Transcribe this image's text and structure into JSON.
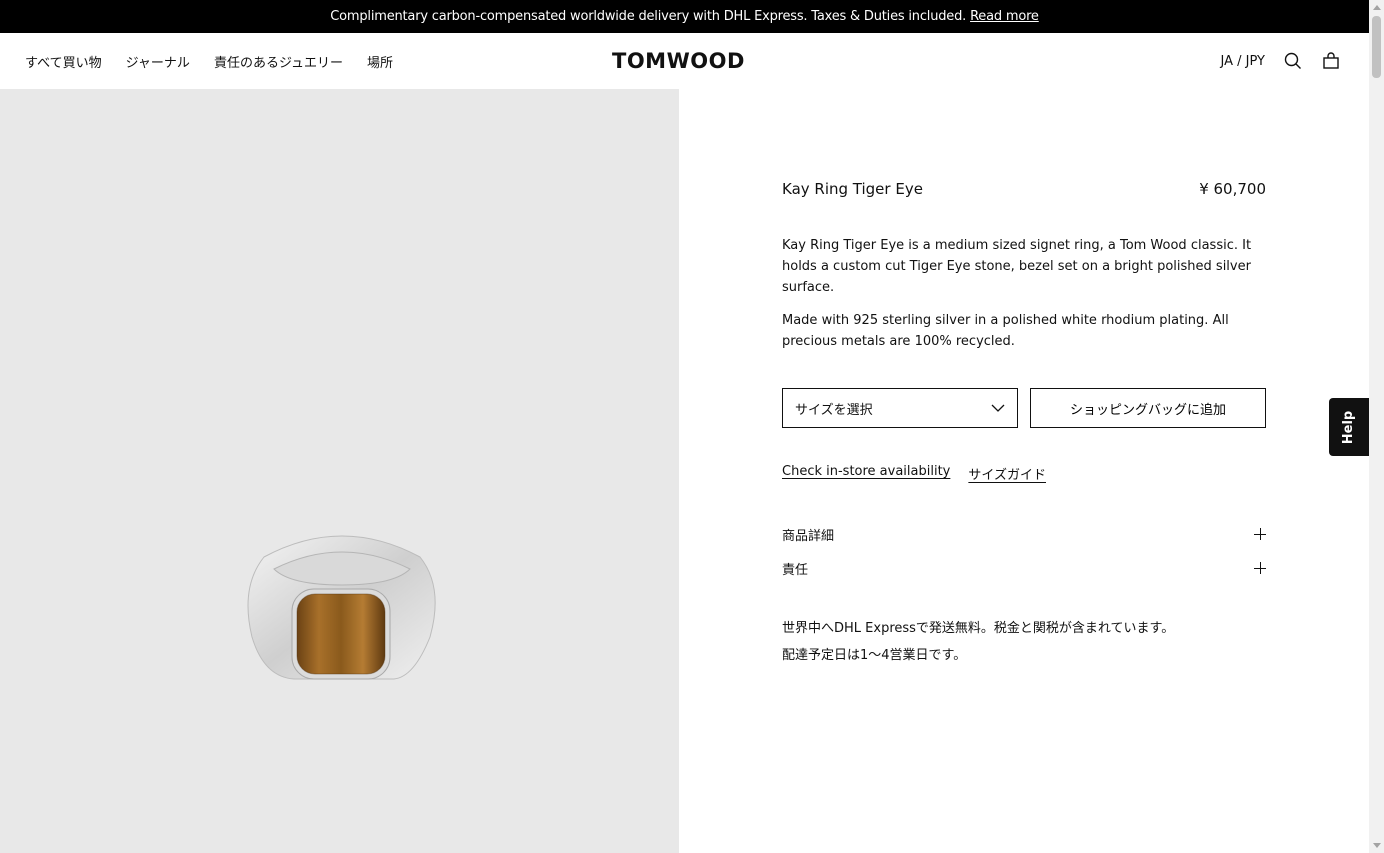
{
  "announcement": {
    "text": "Complimentary carbon-compensated worldwide delivery with DHL Express. Taxes & Duties included.",
    "link": "Read more"
  },
  "nav": {
    "items": [
      "すべて買い物",
      "ジャーナル",
      "責任のあるジュエリー",
      "場所"
    ]
  },
  "brand": {
    "logo": "TOMWOOD"
  },
  "header_right": {
    "locale": "JA / JPY",
    "icons": [
      "search-icon",
      "bag-icon"
    ]
  },
  "product": {
    "name": "Kay Ring Tiger Eye",
    "price": "¥ 60,700",
    "description": [
      "Kay Ring Tiger Eye is a medium sized signet ring, a Tom Wood classic. It holds a custom cut Tiger Eye stone, bezel set on a bright polished silver surface.",
      "Made with 925 sterling silver in a polished white rhodium plating. All precious metals are 100% recycled."
    ],
    "size_select": "サイズを選択",
    "add_to_bag": "ショッピングバッグに追加",
    "links": {
      "store": "Check in-store availability",
      "size_guide": "サイズガイド"
    },
    "accordions": [
      "商品詳細",
      "責任"
    ],
    "shipping": [
      "世界中へDHL Expressで発送無料。税金と関税が含まれています。",
      "配達予定日は1〜4営業日です。"
    ]
  },
  "help": {
    "label": "Help"
  },
  "colors": {
    "announcement_bg": "#000000",
    "gallery_bg": "#e8e8e8",
    "stone": "#9a6420"
  }
}
